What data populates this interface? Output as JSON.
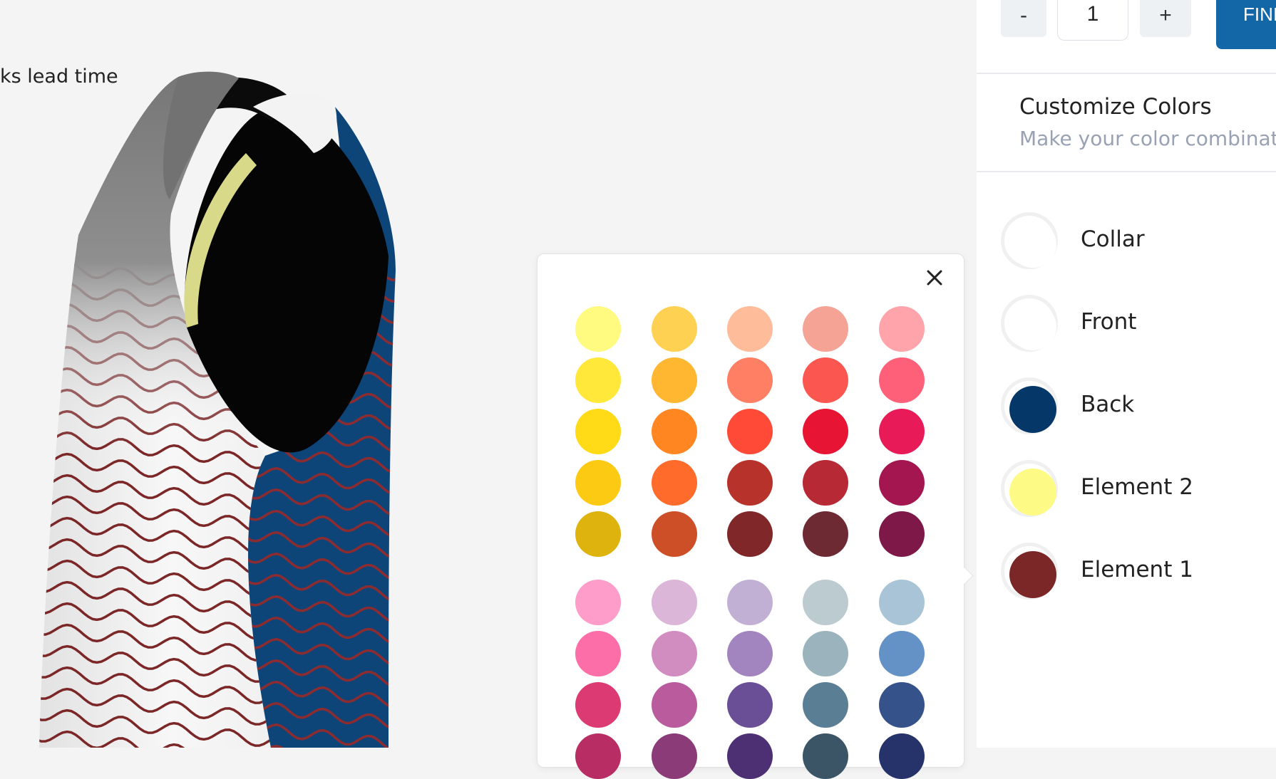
{
  "viewer": {
    "lead_time_text": "ks lead time"
  },
  "quantity": {
    "minus_label": "-",
    "value": "1",
    "plus_label": "+",
    "finish_label": "FINI"
  },
  "customize": {
    "title": "Customize Colors",
    "subtitle": "Make your color combinat"
  },
  "parts": [
    {
      "label": "Collar",
      "color": "#ffffff"
    },
    {
      "label": "Front",
      "color": "#ffffff"
    },
    {
      "label": "Back",
      "color": "#053868"
    },
    {
      "label": "Element 2",
      "color": "#fdfb86"
    },
    {
      "label": "Element 1",
      "color": "#7b2627"
    }
  ],
  "palette": [
    [
      "#fffa80",
      "#ffd152",
      "#ffbc9a",
      "#f5a395",
      "#ffa4aa"
    ],
    [
      "#ffe83a",
      "#ffb630",
      "#fe7f63",
      "#fb5750",
      "#ff6079"
    ],
    [
      "#fedb16",
      "#ff8620",
      "#fe4a37",
      "#e71433",
      "#e81b58"
    ],
    [
      "#fdca13",
      "#fe6b2b",
      "#b7322a",
      "#b72935",
      "#a31650"
    ],
    [
      "#deb30d",
      "#cc4f28",
      "#7f2729",
      "#6d2a32",
      "#7d1848"
    ],
    [
      "#fe9cca",
      "#dcb6d8",
      "#c1b0d4",
      "#bccbcf",
      "#a9c4d6"
    ],
    [
      "#fc6ea8",
      "#d18cc0",
      "#a285be",
      "#9ab3bd",
      "#6592c6"
    ],
    [
      "#dc3a72",
      "#b95b9c",
      "#6a4f97",
      "#5a7f94",
      "#36528b"
    ],
    [
      "#b82d64",
      "#8b3b78",
      "#4d2f74",
      "#3c5566",
      "#26336a"
    ]
  ]
}
